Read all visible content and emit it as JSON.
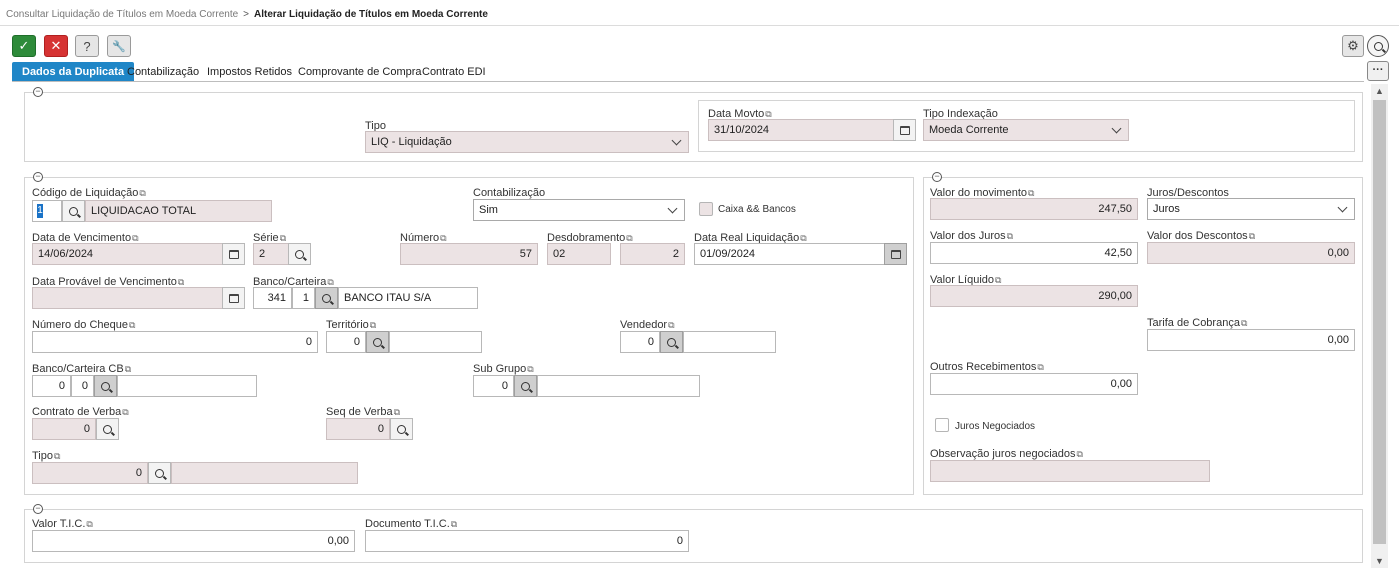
{
  "breadcrumb": {
    "parent": "Consultar Liquidação de Títulos em Moeda Corrente",
    "separator": ">",
    "current": "Alterar Liquidação de Títulos em Moeda Corrente"
  },
  "toolbar": {
    "confirm_icon": "✓",
    "cancel_icon": "✕",
    "help_icon": "?",
    "tools_icon": "🔧",
    "settings_icon": "⚙",
    "search_icon": "⚲",
    "more_icon": "···"
  },
  "tabs": [
    {
      "label": "Dados da Duplicata",
      "active": true
    },
    {
      "label": "Contabilização",
      "active": false
    },
    {
      "label": "Impostos Retidos",
      "active": false
    },
    {
      "label": "Comprovante de Compra",
      "active": false
    },
    {
      "label": "Contrato EDI",
      "active": false
    }
  ],
  "header_section": {
    "tipo": {
      "label": "Tipo",
      "value": "LIQ - Liquidação"
    },
    "data_movto": {
      "label": "Data Movto",
      "value": "31/10/2024"
    },
    "tipo_indexacao": {
      "label": "Tipo Indexação",
      "value": "Moeda Corrente"
    }
  },
  "main_section": {
    "codigo_liquidacao": {
      "label": "Código de Liquidação",
      "code": "1",
      "description": "LIQUIDACAO TOTAL"
    },
    "contabilizacao": {
      "label": "Contabilização",
      "value": "Sim"
    },
    "caixa_bancos": {
      "label": "Caixa && Bancos",
      "checked": false
    },
    "data_vencimento": {
      "label": "Data de Vencimento",
      "value": "14/06/2024"
    },
    "serie": {
      "label": "Série",
      "value": "2"
    },
    "numero": {
      "label": "Número",
      "value": "57"
    },
    "desdobramento": {
      "label": "Desdobramento",
      "value1": "02",
      "value2": "2"
    },
    "data_real_liquidacao": {
      "label": "Data Real Liquidação",
      "value": "01/09/2024"
    },
    "data_provavel_vencimento": {
      "label": "Data Provável de Vencimento",
      "value": ""
    },
    "banco_carteira": {
      "label": "Banco/Carteira",
      "banco": "341",
      "carteira": "1",
      "description": "BANCO ITAU S/A"
    },
    "numero_cheque": {
      "label": "Número do Cheque",
      "value": "0"
    },
    "territorio": {
      "label": "Território",
      "value": "0",
      "description": ""
    },
    "vendedor": {
      "label": "Vendedor",
      "value": "0",
      "description": ""
    },
    "banco_carteira_cb": {
      "label": "Banco/Carteira CB",
      "banco": "0",
      "carteira": "0",
      "description": ""
    },
    "sub_grupo": {
      "label": "Sub Grupo",
      "value": "0",
      "description": ""
    },
    "contrato_verba": {
      "label": "Contrato de Verba",
      "value": "0"
    },
    "seq_verba": {
      "label": "Seq de Verba",
      "value": "0"
    },
    "tipo": {
      "label": "Tipo",
      "value": "0",
      "description": ""
    }
  },
  "values_section": {
    "valor_movimento": {
      "label": "Valor do movimento",
      "value": "247,50"
    },
    "juros_descontos": {
      "label": "Juros/Descontos",
      "value": "Juros"
    },
    "valor_juros": {
      "label": "Valor dos Juros",
      "value": "42,50"
    },
    "valor_descontos": {
      "label": "Valor dos Descontos",
      "value": "0,00"
    },
    "valor_liquido": {
      "label": "Valor Líquido",
      "value": "290,00"
    },
    "tarifa_cobranca": {
      "label": "Tarifa de Cobrança",
      "value": "0,00"
    },
    "outros_recebimentos": {
      "label": "Outros Recebimentos",
      "value": "0,00"
    },
    "juros_negociados": {
      "label": "Juros Negociados",
      "checked": false
    },
    "observacao_juros": {
      "label": "Observação juros negociados",
      "value": ""
    }
  },
  "tic_section": {
    "valor_tic": {
      "label": "Valor T.I.C.",
      "value": "0,00"
    },
    "documento_tic": {
      "label": "Documento T.I.C.",
      "value": "0"
    }
  }
}
